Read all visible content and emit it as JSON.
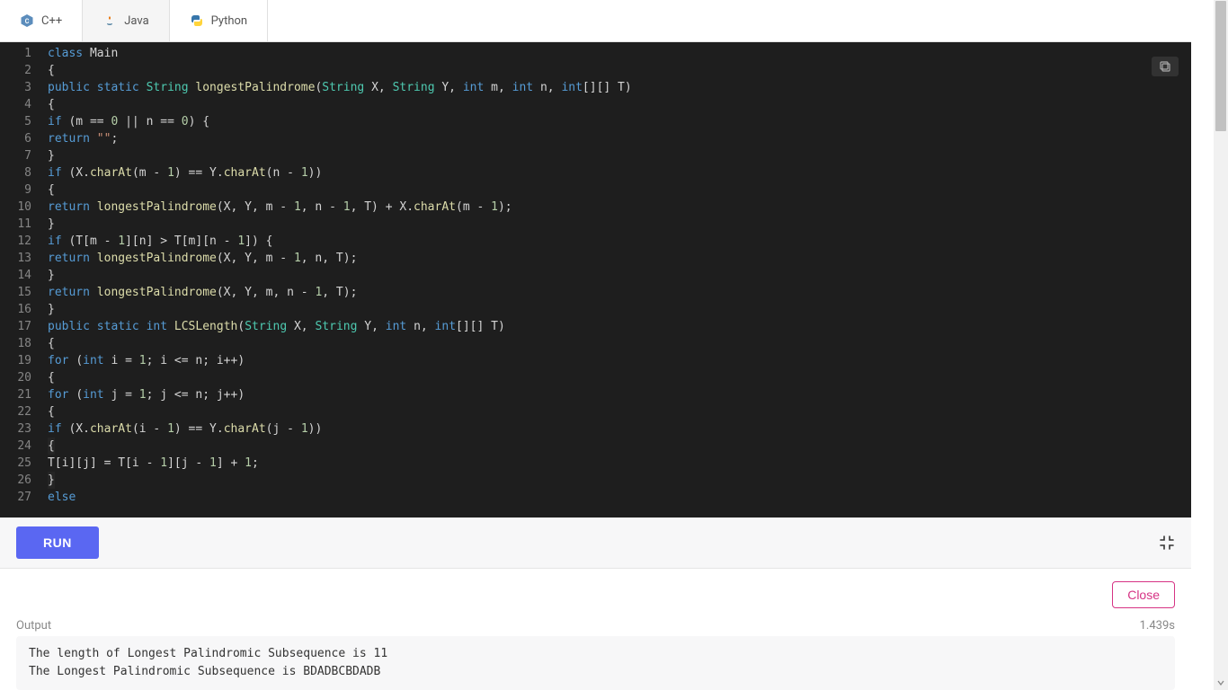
{
  "tabs": [
    {
      "label": "C++",
      "icon": "cpp-icon"
    },
    {
      "label": "Java",
      "icon": "java-icon"
    },
    {
      "label": "Python",
      "icon": "python-icon"
    }
  ],
  "active_tab": "Java",
  "code_lines": [
    {
      "n": 1,
      "tokens": [
        {
          "t": "class ",
          "c": "kw"
        },
        {
          "t": "Main",
          "c": ""
        }
      ]
    },
    {
      "n": 2,
      "tokens": [
        {
          "t": "{",
          "c": ""
        }
      ]
    },
    {
      "n": 3,
      "tokens": [
        {
          "t": "public ",
          "c": "kw"
        },
        {
          "t": "static ",
          "c": "kw"
        },
        {
          "t": "String ",
          "c": "type"
        },
        {
          "t": "longestPalindrome",
          "c": "fn"
        },
        {
          "t": "(",
          "c": ""
        },
        {
          "t": "String ",
          "c": "type"
        },
        {
          "t": "X, ",
          "c": ""
        },
        {
          "t": "String ",
          "c": "type"
        },
        {
          "t": "Y, ",
          "c": ""
        },
        {
          "t": "int ",
          "c": "kw"
        },
        {
          "t": "m, ",
          "c": ""
        },
        {
          "t": "int ",
          "c": "kw"
        },
        {
          "t": "n, ",
          "c": ""
        },
        {
          "t": "int",
          "c": "kw"
        },
        {
          "t": "[][] T)",
          "c": ""
        }
      ]
    },
    {
      "n": 4,
      "tokens": [
        {
          "t": "{",
          "c": ""
        }
      ]
    },
    {
      "n": 5,
      "tokens": [
        {
          "t": "if ",
          "c": "kw"
        },
        {
          "t": "(m == ",
          "c": ""
        },
        {
          "t": "0",
          "c": "num"
        },
        {
          "t": " || n == ",
          "c": ""
        },
        {
          "t": "0",
          "c": "num"
        },
        {
          "t": ") {",
          "c": ""
        }
      ]
    },
    {
      "n": 6,
      "tokens": [
        {
          "t": "return ",
          "c": "kw"
        },
        {
          "t": "\"\"",
          "c": "str"
        },
        {
          "t": ";",
          "c": ""
        }
      ]
    },
    {
      "n": 7,
      "tokens": [
        {
          "t": "}",
          "c": ""
        }
      ]
    },
    {
      "n": 8,
      "tokens": [
        {
          "t": "if ",
          "c": "kw"
        },
        {
          "t": "(X.",
          "c": ""
        },
        {
          "t": "charAt",
          "c": "fn"
        },
        {
          "t": "(m - ",
          "c": ""
        },
        {
          "t": "1",
          "c": "num"
        },
        {
          "t": ") == Y.",
          "c": ""
        },
        {
          "t": "charAt",
          "c": "fn"
        },
        {
          "t": "(n - ",
          "c": ""
        },
        {
          "t": "1",
          "c": "num"
        },
        {
          "t": "))",
          "c": ""
        }
      ]
    },
    {
      "n": 9,
      "tokens": [
        {
          "t": "{",
          "c": ""
        }
      ]
    },
    {
      "n": 10,
      "tokens": [
        {
          "t": "return ",
          "c": "kw"
        },
        {
          "t": "longestPalindrome",
          "c": "fn"
        },
        {
          "t": "(X, Y, m - ",
          "c": ""
        },
        {
          "t": "1",
          "c": "num"
        },
        {
          "t": ", n - ",
          "c": ""
        },
        {
          "t": "1",
          "c": "num"
        },
        {
          "t": ", T) + X.",
          "c": ""
        },
        {
          "t": "charAt",
          "c": "fn"
        },
        {
          "t": "(m - ",
          "c": ""
        },
        {
          "t": "1",
          "c": "num"
        },
        {
          "t": ");",
          "c": ""
        }
      ]
    },
    {
      "n": 11,
      "tokens": [
        {
          "t": "}",
          "c": ""
        }
      ]
    },
    {
      "n": 12,
      "tokens": [
        {
          "t": "if ",
          "c": "kw"
        },
        {
          "t": "(T[m - ",
          "c": ""
        },
        {
          "t": "1",
          "c": "num"
        },
        {
          "t": "][n] > T[m][n - ",
          "c": ""
        },
        {
          "t": "1",
          "c": "num"
        },
        {
          "t": "]) {",
          "c": ""
        }
      ]
    },
    {
      "n": 13,
      "tokens": [
        {
          "t": "return ",
          "c": "kw"
        },
        {
          "t": "longestPalindrome",
          "c": "fn"
        },
        {
          "t": "(X, Y, m - ",
          "c": ""
        },
        {
          "t": "1",
          "c": "num"
        },
        {
          "t": ", n, T);",
          "c": ""
        }
      ]
    },
    {
      "n": 14,
      "tokens": [
        {
          "t": "}",
          "c": ""
        }
      ]
    },
    {
      "n": 15,
      "tokens": [
        {
          "t": "return ",
          "c": "kw"
        },
        {
          "t": "longestPalindrome",
          "c": "fn"
        },
        {
          "t": "(X, Y, m, n - ",
          "c": ""
        },
        {
          "t": "1",
          "c": "num"
        },
        {
          "t": ", T);",
          "c": ""
        }
      ]
    },
    {
      "n": 16,
      "tokens": [
        {
          "t": "}",
          "c": ""
        }
      ]
    },
    {
      "n": 17,
      "tokens": [
        {
          "t": "public ",
          "c": "kw"
        },
        {
          "t": "static ",
          "c": "kw"
        },
        {
          "t": "int ",
          "c": "kw"
        },
        {
          "t": "LCSLength",
          "c": "fn"
        },
        {
          "t": "(",
          "c": ""
        },
        {
          "t": "String ",
          "c": "type"
        },
        {
          "t": "X, ",
          "c": ""
        },
        {
          "t": "String ",
          "c": "type"
        },
        {
          "t": "Y, ",
          "c": ""
        },
        {
          "t": "int ",
          "c": "kw"
        },
        {
          "t": "n, ",
          "c": ""
        },
        {
          "t": "int",
          "c": "kw"
        },
        {
          "t": "[][] T)",
          "c": ""
        }
      ]
    },
    {
      "n": 18,
      "tokens": [
        {
          "t": "{",
          "c": ""
        }
      ]
    },
    {
      "n": 19,
      "tokens": [
        {
          "t": "for ",
          "c": "kw"
        },
        {
          "t": "(",
          "c": ""
        },
        {
          "t": "int ",
          "c": "kw"
        },
        {
          "t": "i = ",
          "c": ""
        },
        {
          "t": "1",
          "c": "num"
        },
        {
          "t": "; i <= n; i++)",
          "c": ""
        }
      ]
    },
    {
      "n": 20,
      "tokens": [
        {
          "t": "{",
          "c": ""
        }
      ]
    },
    {
      "n": 21,
      "tokens": [
        {
          "t": "for ",
          "c": "kw"
        },
        {
          "t": "(",
          "c": ""
        },
        {
          "t": "int ",
          "c": "kw"
        },
        {
          "t": "j = ",
          "c": ""
        },
        {
          "t": "1",
          "c": "num"
        },
        {
          "t": "; j <= n; j++)",
          "c": ""
        }
      ]
    },
    {
      "n": 22,
      "tokens": [
        {
          "t": "{",
          "c": ""
        }
      ]
    },
    {
      "n": 23,
      "tokens": [
        {
          "t": "if ",
          "c": "kw"
        },
        {
          "t": "(X.",
          "c": ""
        },
        {
          "t": "charAt",
          "c": "fn"
        },
        {
          "t": "(i - ",
          "c": ""
        },
        {
          "t": "1",
          "c": "num"
        },
        {
          "t": ") == Y.",
          "c": ""
        },
        {
          "t": "charAt",
          "c": "fn"
        },
        {
          "t": "(j - ",
          "c": ""
        },
        {
          "t": "1",
          "c": "num"
        },
        {
          "t": "))",
          "c": ""
        }
      ]
    },
    {
      "n": 24,
      "tokens": [
        {
          "t": "{",
          "c": "hl-gray"
        }
      ]
    },
    {
      "n": 25,
      "tokens": [
        {
          "t": "T[i][j] = T[i - ",
          "c": ""
        },
        {
          "t": "1",
          "c": "num"
        },
        {
          "t": "][j - ",
          "c": ""
        },
        {
          "t": "1",
          "c": "num"
        },
        {
          "t": "] + ",
          "c": ""
        },
        {
          "t": "1",
          "c": "num"
        },
        {
          "t": ";",
          "c": ""
        }
      ]
    },
    {
      "n": 26,
      "tokens": [
        {
          "t": "}",
          "c": "hl-gray"
        }
      ]
    },
    {
      "n": 27,
      "tokens": [
        {
          "t": "else",
          "c": "kw"
        }
      ]
    }
  ],
  "run_bar": {
    "run_label": "RUN"
  },
  "output": {
    "close_label": "Close",
    "output_label": "Output",
    "time_label": "1.439s",
    "lines": [
      "The length of Longest Palindromic Subsequence is 11",
      "The Longest Palindromic Subsequence is BDADBCBDADB"
    ]
  }
}
